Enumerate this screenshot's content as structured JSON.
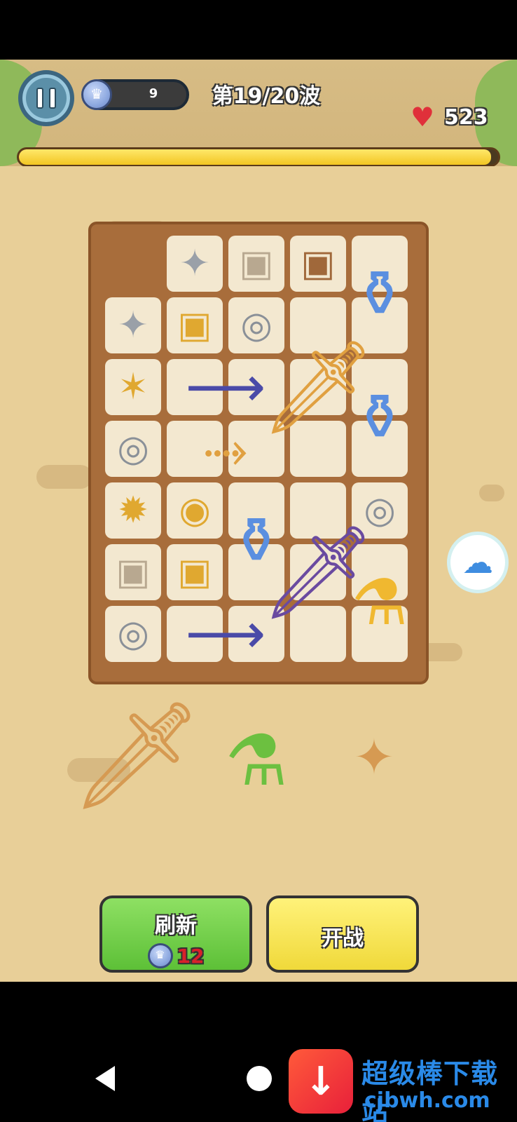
{
  "hud": {
    "gems": "9",
    "wave": "第19/20波",
    "health": "523",
    "wave_progress": 0.985
  },
  "board_items": [
    {
      "name": "shuriken-silver",
      "glyph": "✦",
      "color": "#9aa0a8"
    },
    {
      "name": "chest-silver",
      "glyph": "▣",
      "color": "#b8a890"
    },
    {
      "name": "chest-wood",
      "glyph": "▣",
      "color": "#a0683a"
    },
    {
      "name": "potion-blue-tall",
      "glyph": "⚱",
      "color": "#5b8fe0"
    },
    {
      "name": "shuriken-silver",
      "glyph": "✦",
      "color": "#9aa0a8"
    },
    {
      "name": "chest-gold",
      "glyph": "▣",
      "color": "#e0a830"
    },
    {
      "name": "ring-silver",
      "glyph": "◎",
      "color": "#8a9098"
    },
    {
      "name": "sword-gold-large",
      "glyph": "🗡",
      "color": "#e0a040"
    },
    {
      "name": "shuriken-gold",
      "glyph": "✶",
      "color": "#e0a830"
    },
    {
      "name": "spear-blue",
      "glyph": "⟶",
      "color": "#4a4aa8"
    },
    {
      "name": "potion-blue-tall",
      "glyph": "⚱",
      "color": "#5b8fe0"
    },
    {
      "name": "ring-silver",
      "glyph": "◎",
      "color": "#8a9098"
    },
    {
      "name": "knife-gold",
      "glyph": "⤑",
      "color": "#e0a040"
    },
    {
      "name": "shuriken-star-gold",
      "glyph": "✹",
      "color": "#e0a830"
    },
    {
      "name": "ring-gold",
      "glyph": "◉",
      "color": "#e0a830"
    },
    {
      "name": "potion-blue-tall",
      "glyph": "⚱",
      "color": "#5b8fe0"
    },
    {
      "name": "staff-purple",
      "glyph": "🗡",
      "color": "#6a4aa0"
    },
    {
      "name": "ring-silver",
      "glyph": "◎",
      "color": "#8a9098"
    },
    {
      "name": "chest-silver",
      "glyph": "▣",
      "color": "#b8a890"
    },
    {
      "name": "chest-gold",
      "glyph": "▣",
      "color": "#e0a830"
    },
    {
      "name": "potion-yellow",
      "glyph": "⚗",
      "color": "#f0b830"
    },
    {
      "name": "ring-silver",
      "glyph": "◎",
      "color": "#8a9098"
    },
    {
      "name": "spear-blue",
      "glyph": "⟶",
      "color": "#4a4aa8"
    }
  ],
  "ground_items": [
    {
      "name": "wooden-sword",
      "glyph": "🗡",
      "color": "#d69a52"
    },
    {
      "name": "green-vial",
      "glyph": "⚗",
      "color": "#6cc040"
    },
    {
      "name": "bronze-shuriken",
      "glyph": "✦",
      "color": "#d69a52"
    }
  ],
  "buttons": {
    "refresh_label": "刷新",
    "refresh_cost": "12",
    "fight_label": "开战"
  },
  "watermark": {
    "text": "超级棒下载站",
    "url": "cjbwh.com"
  }
}
